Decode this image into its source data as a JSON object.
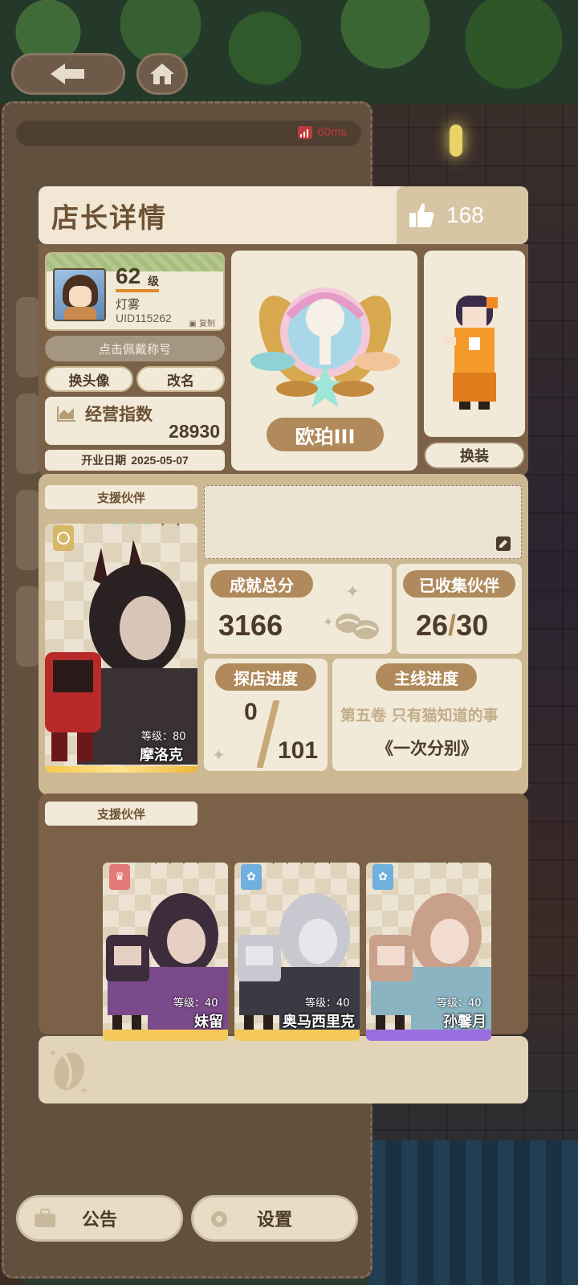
{
  "network": {
    "ping": "60ms"
  },
  "detail": {
    "title": "店长详情",
    "likes": "168"
  },
  "profile": {
    "level": "62",
    "level_unit": "级",
    "nickname": "灯雾",
    "uid": "UID115262",
    "copy_label": "复制",
    "wear_title_label": "点击佩戴称号",
    "change_avatar_label": "换头像",
    "rename_label": "改名",
    "business_index_label": "经营指数",
    "business_index_value": "28930",
    "open_date_label": "开业日期",
    "open_date_value": "2025-05-07"
  },
  "badge": {
    "rank": "欧珀III"
  },
  "outfit": {
    "change_label": "换装"
  },
  "main_partner": {
    "section_label": "支援伙伴",
    "level": "等级：80",
    "name": "摩洛克",
    "stars_on": 3,
    "stars_total": 5
  },
  "stats": {
    "achievement_label": "成就总分",
    "achievement_value": "3166",
    "collected_label": "已收集伙伴",
    "collected_value": "26",
    "collected_total": "30",
    "explore_label": "探店进度",
    "explore_value": "0",
    "explore_total": "101",
    "story_label": "主线进度",
    "story_chapter": "第五卷 只有猫知道的事",
    "story_title": "《一次分别》"
  },
  "support_partners": {
    "section_label": "支援伙伴",
    "items": [
      {
        "name": "妹留",
        "level": "等级：40",
        "stars_on": 1,
        "tag": "chef-icon",
        "tag_color": "#e27a78",
        "strip_color": "#f4c85a"
      },
      {
        "name": "奥马西里克",
        "level": "等级：40",
        "stars_on": 0,
        "tag": "bow-icon",
        "tag_color": "#6fb0de",
        "strip_color": "#f4c85a"
      },
      {
        "name": "孙馨月",
        "level": "等级：40",
        "stars_on": 3,
        "tag": "bow-icon",
        "tag_color": "#6fb0de",
        "strip_color": "#9a6ee0"
      }
    ]
  },
  "bottom_buttons": {
    "notice_label": "公告",
    "settings_label": "设置"
  }
}
